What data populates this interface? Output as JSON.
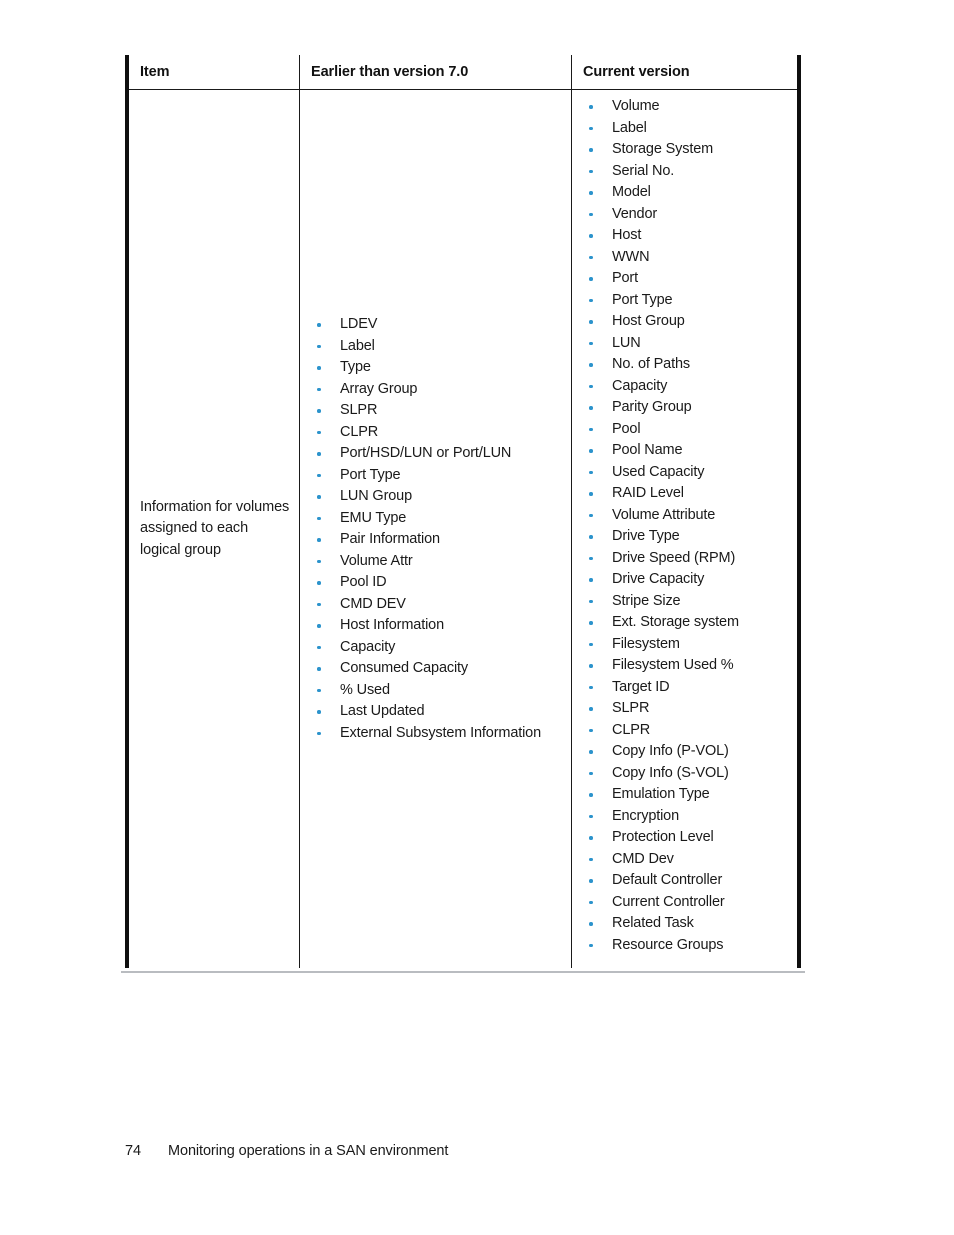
{
  "document": {
    "footer": {
      "page_number": "74",
      "chapter_title": "Monitoring operations in a SAN environment"
    }
  },
  "colors": {
    "bullet": "#2b93cc",
    "border": "#0f0f0f",
    "text": "#1a1a1a"
  },
  "table": {
    "headers": {
      "item": "Item",
      "earlier": "Earlier than version 7.0",
      "current": "Current version"
    },
    "rows": [
      {
        "item": "Information for volumes assigned to each logical group",
        "earlier_items": [
          "LDEV",
          "Label",
          "Type",
          "Array Group",
          "SLPR",
          "CLPR",
          "Port/HSD/LUN or Port/LUN",
          "Port Type",
          "LUN Group",
          "EMU Type",
          "Pair Information",
          "Volume Attr",
          "Pool ID",
          "CMD DEV",
          "Host Information",
          "Capacity",
          "Consumed Capacity",
          "% Used",
          "Last Updated",
          "External Subsystem Information"
        ],
        "current_items": [
          "Volume",
          "Label",
          "Storage System",
          "Serial No.",
          "Model",
          "Vendor",
          "Host",
          "WWN",
          "Port",
          "Port Type",
          "Host Group",
          "LUN",
          "No. of Paths",
          "Capacity",
          "Parity Group",
          "Pool",
          "Pool Name",
          "Used Capacity",
          "RAID Level",
          "Volume Attribute",
          "Drive Type",
          "Drive Speed (RPM)",
          "Drive Capacity",
          "Stripe Size",
          "Ext. Storage system",
          "Filesystem",
          "Filesystem Used %",
          "Target ID",
          "SLPR",
          "CLPR",
          "Copy Info (P-VOL)",
          "Copy Info (S-VOL)",
          "Emulation Type",
          "Encryption",
          "Protection Level",
          "CMD Dev",
          "Default Controller",
          "Current Controller",
          "Related Task",
          "Resource Groups"
        ]
      }
    ]
  }
}
